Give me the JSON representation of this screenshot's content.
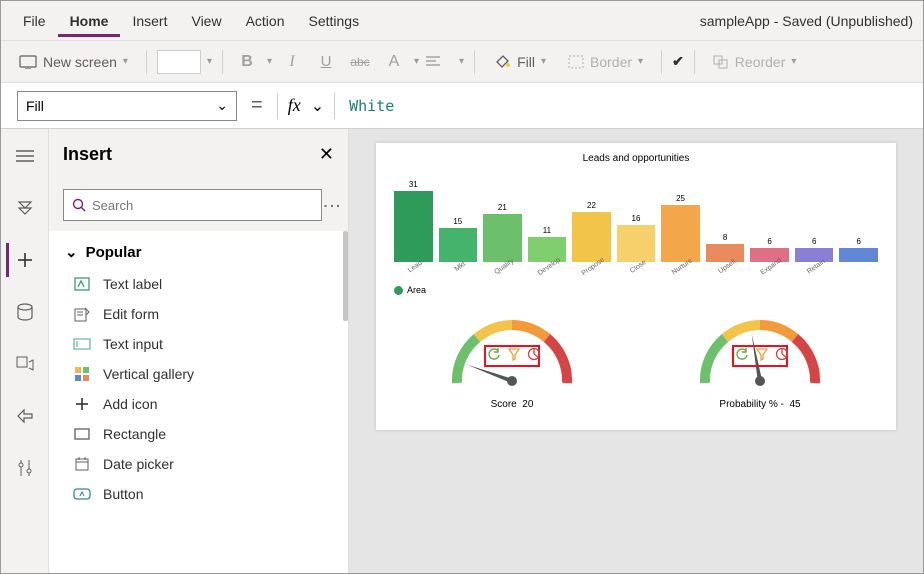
{
  "menubar": {
    "items": [
      "File",
      "Home",
      "Insert",
      "View",
      "Action",
      "Settings"
    ],
    "active_index": 1,
    "status": "sampleApp - Saved (Unpublished)"
  },
  "ribbon": {
    "new_screen": "New screen",
    "fill": "Fill",
    "border": "Border",
    "reorder": "Reorder"
  },
  "formula": {
    "property": "Fill",
    "value": "White"
  },
  "insert": {
    "title": "Insert",
    "search_placeholder": "Search",
    "category": "Popular",
    "items": [
      {
        "label": "Text label",
        "icon": "text-label-icon"
      },
      {
        "label": "Edit form",
        "icon": "edit-form-icon"
      },
      {
        "label": "Text input",
        "icon": "text-input-icon"
      },
      {
        "label": "Vertical gallery",
        "icon": "gallery-icon"
      },
      {
        "label": "Add icon",
        "icon": "plus-icon"
      },
      {
        "label": "Rectangle",
        "icon": "rectangle-icon"
      },
      {
        "label": "Date picker",
        "icon": "calendar-icon"
      },
      {
        "label": "Button",
        "icon": "button-icon"
      }
    ]
  },
  "chart_data": {
    "type": "bar",
    "title": "Leads and opportunities",
    "categories": [
      "Lead",
      "Mkt",
      "Qualify",
      "Develop",
      "Propose",
      "Close",
      "Nurture",
      "Upsell",
      "Expand",
      "Retain"
    ],
    "values": [
      31,
      15,
      21,
      11,
      22,
      16,
      25,
      8,
      6,
      6,
      6
    ],
    "colors": [
      "#2e9b5a",
      "#46b36c",
      "#6cc06c",
      "#7fcf6f",
      "#f3c44a",
      "#f6d06b",
      "#f3a64a",
      "#e98b5c",
      "#de6f84",
      "#8a7fd6",
      "#5f87d6"
    ],
    "legend": "Area",
    "ylim": [
      0,
      35
    ]
  },
  "gauges": [
    {
      "label": "Score",
      "value": 20,
      "needle_angle": -70
    },
    {
      "label": "Probability % -",
      "value": 45,
      "needle_angle": -10
    }
  ]
}
